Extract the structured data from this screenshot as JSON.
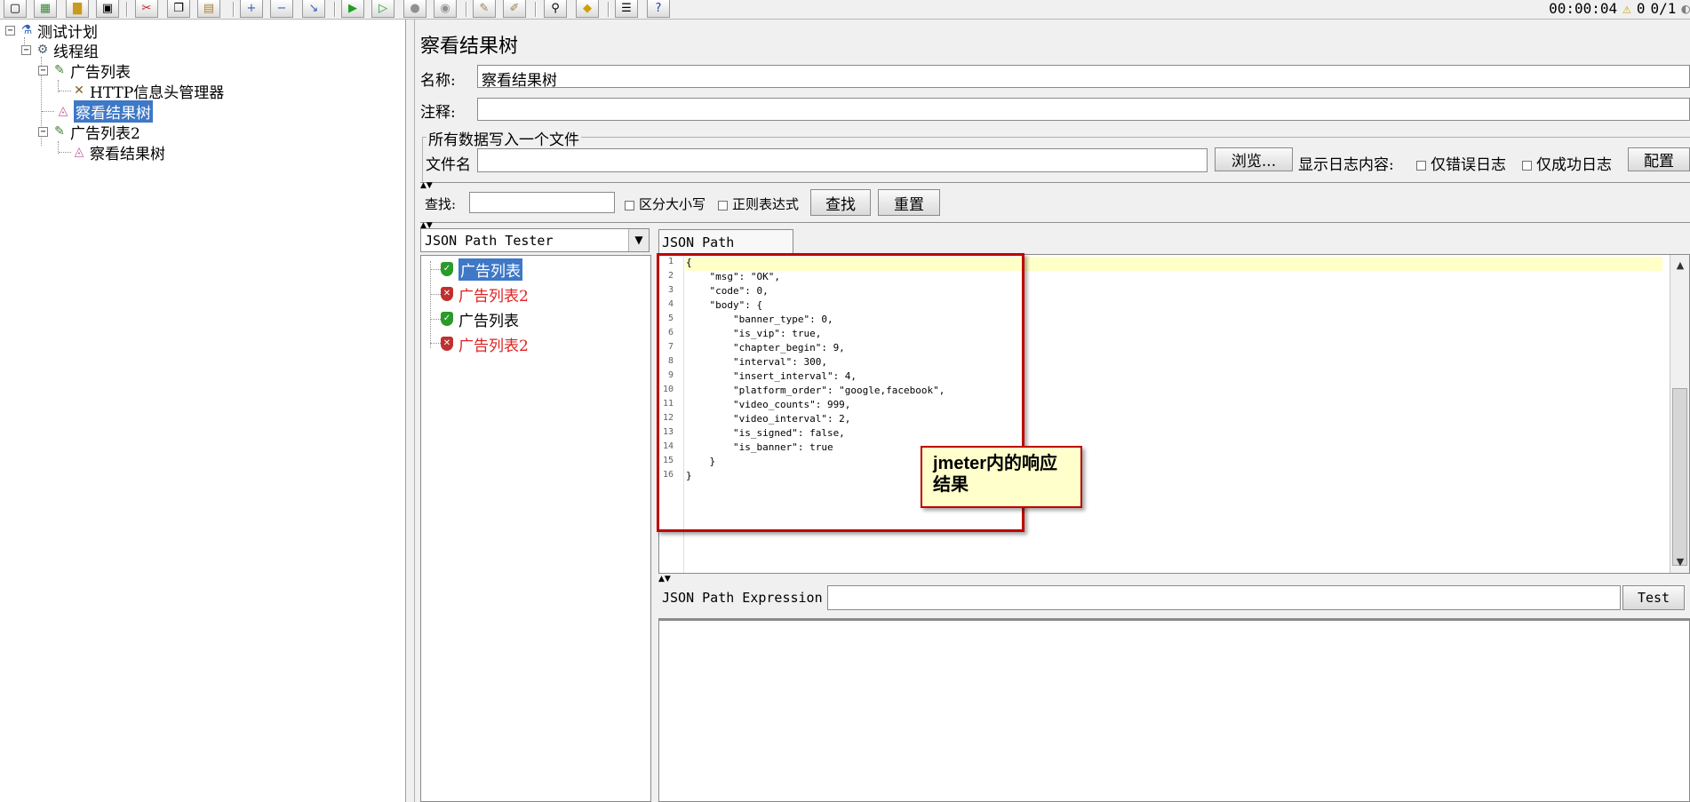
{
  "toolbar": {
    "buttons": [
      "new-icon",
      "open-template-icon",
      "open-icon",
      "save-icon",
      "cut-icon",
      "copy-icon",
      "paste-icon",
      "expand-icon",
      "collapse-icon",
      "toggle-icon",
      "start-icon",
      "start-no-pause-icon",
      "stop-icon",
      "shutdown-icon",
      "clear-icon",
      "clear-all-icon",
      "search-icon",
      "reset-search-icon",
      "function-helper-icon",
      "help-icon"
    ],
    "elapsed_time": "00:00:04",
    "warning_count": "0",
    "threads": "0/1"
  },
  "test_tree": {
    "nodes": [
      {
        "label": "测试计划",
        "icon": "test-plan-icon"
      },
      {
        "label": "线程组",
        "icon": "thread-group-icon"
      },
      {
        "label": "广告列表",
        "icon": "http-sampler-icon"
      },
      {
        "label": "HTTP信息头管理器",
        "icon": "header-manager-icon"
      },
      {
        "label": "察看结果树",
        "icon": "listener-icon"
      },
      {
        "label": "广告列表2",
        "icon": "http-sampler-icon"
      },
      {
        "label": "察看结果树",
        "icon": "listener-icon"
      }
    ]
  },
  "panel": {
    "title": "察看结果树",
    "name_label": "名称:",
    "name_value": "察看结果树",
    "comment_label": "注释:",
    "comment_value": "",
    "file_group_title": "所有数据写入一个文件",
    "file_label": "文件名",
    "file_value": "",
    "browse_button": "浏览...",
    "log_label": "显示日志内容:",
    "errors_only": "仅错误日志",
    "success_only": "仅成功日志",
    "configure_button": "配置",
    "search_label": "查找:",
    "search_value": "",
    "case_sensitive": "区分大小写",
    "regex": "正则表达式",
    "find_button": "查找",
    "reset_button": "重置",
    "renderer_selected": "JSON Path Tester",
    "tab_label": "JSON Path Tester",
    "expression_label": "JSON Path Expression",
    "expression_value": "",
    "test_button": "Test"
  },
  "results": [
    {
      "label": "广告列表",
      "status": "success",
      "color": "#000000"
    },
    {
      "label": "广告列表2",
      "status": "error",
      "color": "#e02020"
    },
    {
      "label": "广告列表",
      "status": "success",
      "color": "#000000"
    },
    {
      "label": "广告列表2",
      "status": "error",
      "color": "#e02020"
    }
  ],
  "response_lines": [
    "{",
    "    \"msg\": \"OK\",",
    "    \"code\": 0,",
    "    \"body\": {",
    "        \"banner_type\": 0,",
    "        \"is_vip\": true,",
    "        \"chapter_begin\": 9,",
    "        \"interval\": 300,",
    "        \"insert_interval\": 4,",
    "        \"platform_order\": \"google,facebook\",",
    "        \"video_counts\": 999,",
    "        \"video_interval\": 2,",
    "        \"is_signed\": false,",
    "        \"is_banner\": true",
    "    }",
    "}"
  ],
  "callout": {
    "line1": "jmeter内的响应",
    "line2": "结果"
  },
  "colors": {
    "selection": "#3e78c6",
    "error_text": "#e02020",
    "annotation_border": "#c00000",
    "annotation_fill": "#ffffcc"
  }
}
